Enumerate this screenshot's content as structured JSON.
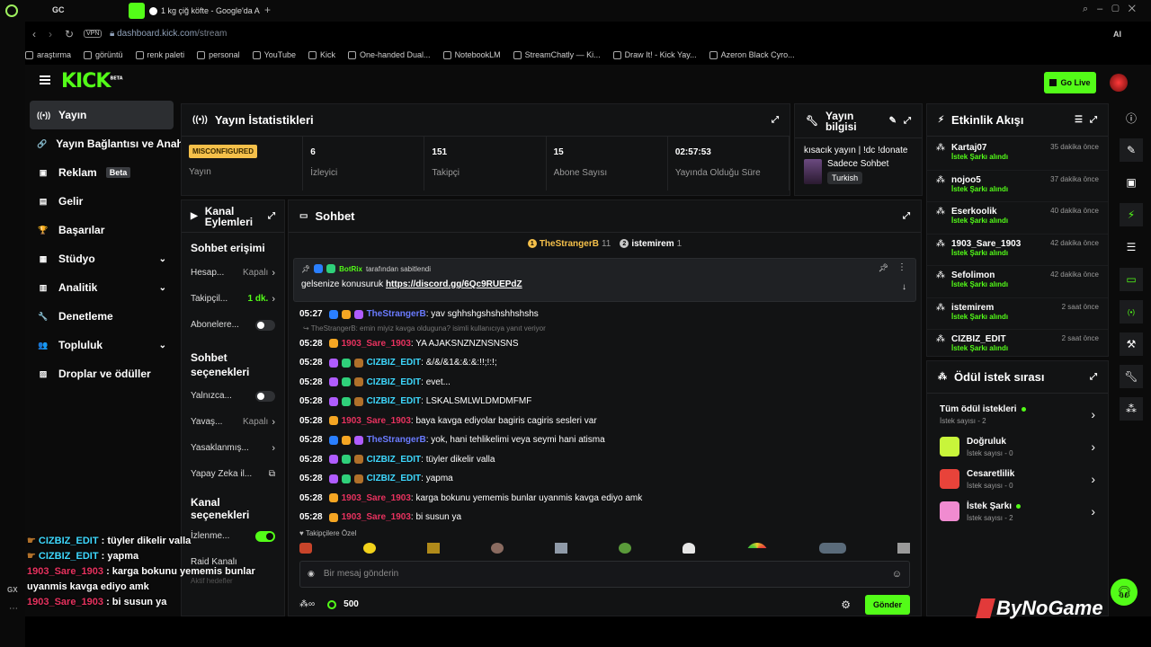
{
  "browser": {
    "tab_title": "1 kg çiğ köfte - Google'da A",
    "vpn": "VPN",
    "url_host": "dashboard.kick.com",
    "url_path": "/stream",
    "gc": "GC",
    "ai": "AI",
    "gx": "GX",
    "bookmarks": [
      "araştırma",
      "görüntü",
      "renk paleti",
      "personal",
      "YouTube",
      "Kick",
      "One-handed Dual...",
      "NotebookLM",
      "StreamChatly — Ki...",
      "Draw It! - Kick Yay...",
      "Azeron Black Cyro..."
    ]
  },
  "header": {
    "logo": "KICK",
    "logo_beta": "BETA",
    "go_live": "Go Live"
  },
  "sidebar": {
    "items": [
      {
        "label": "Yayın",
        "icon": "broadcast-icon",
        "glyph": "((•))",
        "active": true
      },
      {
        "label": "Yayın Bağlantısı ve Anahtar",
        "icon": "link-icon",
        "glyph": "🔗"
      },
      {
        "label": "Reklam",
        "icon": "ad-icon",
        "glyph": "▣",
        "badge": "Beta"
      },
      {
        "label": "Gelir",
        "icon": "revenue-icon",
        "glyph": "▤"
      },
      {
        "label": "Başarılar",
        "icon": "trophy-icon",
        "glyph": "🏆"
      },
      {
        "label": "Stüdyo",
        "icon": "studio-icon",
        "glyph": "▦",
        "chevron": true
      },
      {
        "label": "Analitik",
        "icon": "analytics-icon",
        "glyph": "▥",
        "chevron": true
      },
      {
        "label": "Denetleme",
        "icon": "moderation-icon",
        "glyph": "🔧"
      },
      {
        "label": "Topluluk",
        "icon": "community-icon",
        "glyph": "👥",
        "chevron": true
      },
      {
        "label": "Droplar ve ödüller",
        "icon": "drops-icon",
        "glyph": "▨"
      }
    ]
  },
  "stats": {
    "title": "Yayın İstatistikleri",
    "status_badge": "MISCONFIGURED",
    "status_label": "Yayın",
    "cols": [
      {
        "value": "6",
        "label": "İzleyici"
      },
      {
        "value": "151",
        "label": "Takipçi"
      },
      {
        "value": "15",
        "label": "Abone Sayısı"
      },
      {
        "value": "02:57:53",
        "label": "Yayında Olduğu Süre"
      }
    ]
  },
  "stream_info": {
    "title": "Yayın bilgisi",
    "stream_title": "kısacık yayın | !dc !donate",
    "category": "Sadece Sohbet",
    "language": "Turkish"
  },
  "channel_actions": {
    "title": "Kanal Eylemleri",
    "chat_access_title": "Sohbet erişimi",
    "chat_access": [
      {
        "label": "Hesap...",
        "value": "Kapalı",
        "type": "chevron"
      },
      {
        "label": "Takipçil...",
        "value": "1 dk.",
        "type": "chevron",
        "green": true
      },
      {
        "label": "Abonelere...",
        "value": "",
        "type": "toggle",
        "on": false
      }
    ],
    "chat_options_title": "Sohbet seçenekleri",
    "chat_options": [
      {
        "label": "Yalnızca...",
        "value": "",
        "type": "toggle",
        "on": false
      },
      {
        "label": "Yavaş...",
        "value": "Kapalı",
        "type": "chevron"
      },
      {
        "label": "Yasaklanmış...",
        "value": "",
        "type": "chevron"
      },
      {
        "label": "Yapay Zeka il...",
        "value": "",
        "type": "external"
      }
    ],
    "channel_options_title": "Kanal seçenekleri",
    "channel_options": [
      {
        "label": "İzlenme...",
        "value": "",
        "type": "toggle",
        "on": true
      },
      {
        "label": "Raid Kanalı",
        "value": "",
        "type": "none"
      }
    ],
    "faded": "Aktif hedefler"
  },
  "chat": {
    "title": "Sohbet",
    "top_gifters": [
      {
        "rank": "1",
        "name": "TheStrangerB",
        "count": "11"
      },
      {
        "rank": "2",
        "name": "istemirem",
        "count": "1"
      }
    ],
    "pinned_by": "BotRix",
    "pinned_suffix": "tarafından sabitlendi",
    "pinned_text": "gelsenize konusuruk",
    "pinned_link": "https://discord.gg/6Qc9RUEPdZ",
    "reply_note": "TheStrangerB: emin miyiz kavga olduguna? isimli kullanıcıya yanıt veriyor",
    "messages": [
      {
        "time": "05:27",
        "user": "TheStrangerB",
        "color": "#6a7bff",
        "badges": [
          "#2a7fff",
          "#f5a623",
          "#b05cff"
        ],
        "text": ": yav sghhshgshshshhshshs"
      },
      {
        "time": "05:28",
        "user": "1903_Sare_1903",
        "color": "#e8325f",
        "badges": [
          "#f5a623"
        ],
        "text": ": YA AJAKSNZNZNSNSNS"
      },
      {
        "time": "05:28",
        "user": "CIZBIZ_EDIT",
        "color": "#3ed9ff",
        "badges": [
          "#b05cff",
          "#2fd07a",
          "#b0702a"
        ],
        "text": ": &/&/&1&:&:&:!!;!:!;"
      },
      {
        "time": "05:28",
        "user": "CIZBIZ_EDIT",
        "color": "#3ed9ff",
        "badges": [
          "#b05cff",
          "#2fd07a",
          "#b0702a"
        ],
        "text": ": evet..."
      },
      {
        "time": "05:28",
        "user": "CIZBIZ_EDIT",
        "color": "#3ed9ff",
        "badges": [
          "#b05cff",
          "#2fd07a",
          "#b0702a"
        ],
        "text": ": LSKALSMLWLDMDMFMF"
      },
      {
        "time": "05:28",
        "user": "1903_Sare_1903",
        "color": "#e8325f",
        "badges": [
          "#f5a623"
        ],
        "text": ": baya kavga ediyolar bagiris cagiris sesleri var"
      },
      {
        "time": "05:28",
        "user": "TheStrangerB",
        "color": "#6a7bff",
        "badges": [
          "#2a7fff",
          "#f5a623",
          "#b05cff"
        ],
        "text": ": yok, hani tehlikelimi veya seymi hani atisma"
      },
      {
        "time": "05:28",
        "user": "CIZBIZ_EDIT",
        "color": "#3ed9ff",
        "badges": [
          "#b05cff",
          "#2fd07a",
          "#b0702a"
        ],
        "text": ": tüyler dikelir valla"
      },
      {
        "time": "05:28",
        "user": "CIZBIZ_EDIT",
        "color": "#3ed9ff",
        "badges": [
          "#b05cff",
          "#2fd07a",
          "#b0702a"
        ],
        "text": ": yapma"
      },
      {
        "time": "05:28",
        "user": "1903_Sare_1903",
        "color": "#e8325f",
        "badges": [
          "#f5a623"
        ],
        "text": ": karga bokunu yememis bunlar uyanmis kavga ediyo amk"
      },
      {
        "time": "05:28",
        "user": "1903_Sare_1903",
        "color": "#e8325f",
        "badges": [
          "#f5a623"
        ],
        "text": ": bi susun ya"
      }
    ],
    "followers_only": "Takipçilere Özel",
    "input_placeholder": "Bir mesaj gönderin",
    "points": "500",
    "send": "Gönder"
  },
  "activity": {
    "title": "Etkinlik Akışı",
    "items": [
      {
        "name": "Kartaj07",
        "sub": "İstek Şarkı alındı",
        "time": "35 dakika önce"
      },
      {
        "name": "nojoo5",
        "sub": "İstek Şarkı alındı",
        "time": "37 dakika önce"
      },
      {
        "name": "Eserkoolik",
        "sub": "İstek Şarkı alındı",
        "time": "40 dakika önce"
      },
      {
        "name": "1903_Sare_1903",
        "sub": "İstek Şarkı alındı",
        "time": "42 dakika önce"
      },
      {
        "name": "Sefolimon",
        "sub": "İstek Şarkı alındı",
        "time": "42 dakika önce"
      },
      {
        "name": "istemirem",
        "sub": "İstek Şarkı alındı",
        "time": "2 saat önce"
      },
      {
        "name": "CIZBIZ_EDIT",
        "sub": "İstek Şarkı alındı",
        "time": "2 saat önce"
      }
    ]
  },
  "rewards": {
    "title": "Ödül istek sırası",
    "items": [
      {
        "name": "Tüm ödül istekleri",
        "count": "İstek sayısı - 2",
        "dot": true,
        "color": ""
      },
      {
        "name": "Doğruluk",
        "count": "İstek sayısı - 0",
        "dot": false,
        "color": "#c8f53a"
      },
      {
        "name": "Cesaretlilik",
        "count": "İstek sayısı - 0",
        "dot": false,
        "color": "#e8433a"
      },
      {
        "name": "İstek Şarkı",
        "count": "İstek sayısı - 2",
        "dot": true,
        "color": "#f08bd0"
      }
    ]
  },
  "overlay_chat": [
    {
      "user": "CIZBIZ_EDIT",
      "color": "#3ed9ff",
      "text": " : tüyler dikelir valla"
    },
    {
      "user": "CIZBIZ_EDIT",
      "color": "#3ed9ff",
      "text": " : yapma"
    },
    {
      "user": "1903_Sare_1903",
      "color": "#e8325f",
      "text": " : karga bokunu yememis bunlar uyanmis kavga ediyo amk"
    },
    {
      "user": "1903_Sare_1903",
      "color": "#e8325f",
      "text": " : bi susun ya"
    }
  ],
  "watermark": "ByNoGame",
  "colors": {
    "accent": "#53fc18",
    "panel": "#121314",
    "bg": "#0b0b0b"
  }
}
